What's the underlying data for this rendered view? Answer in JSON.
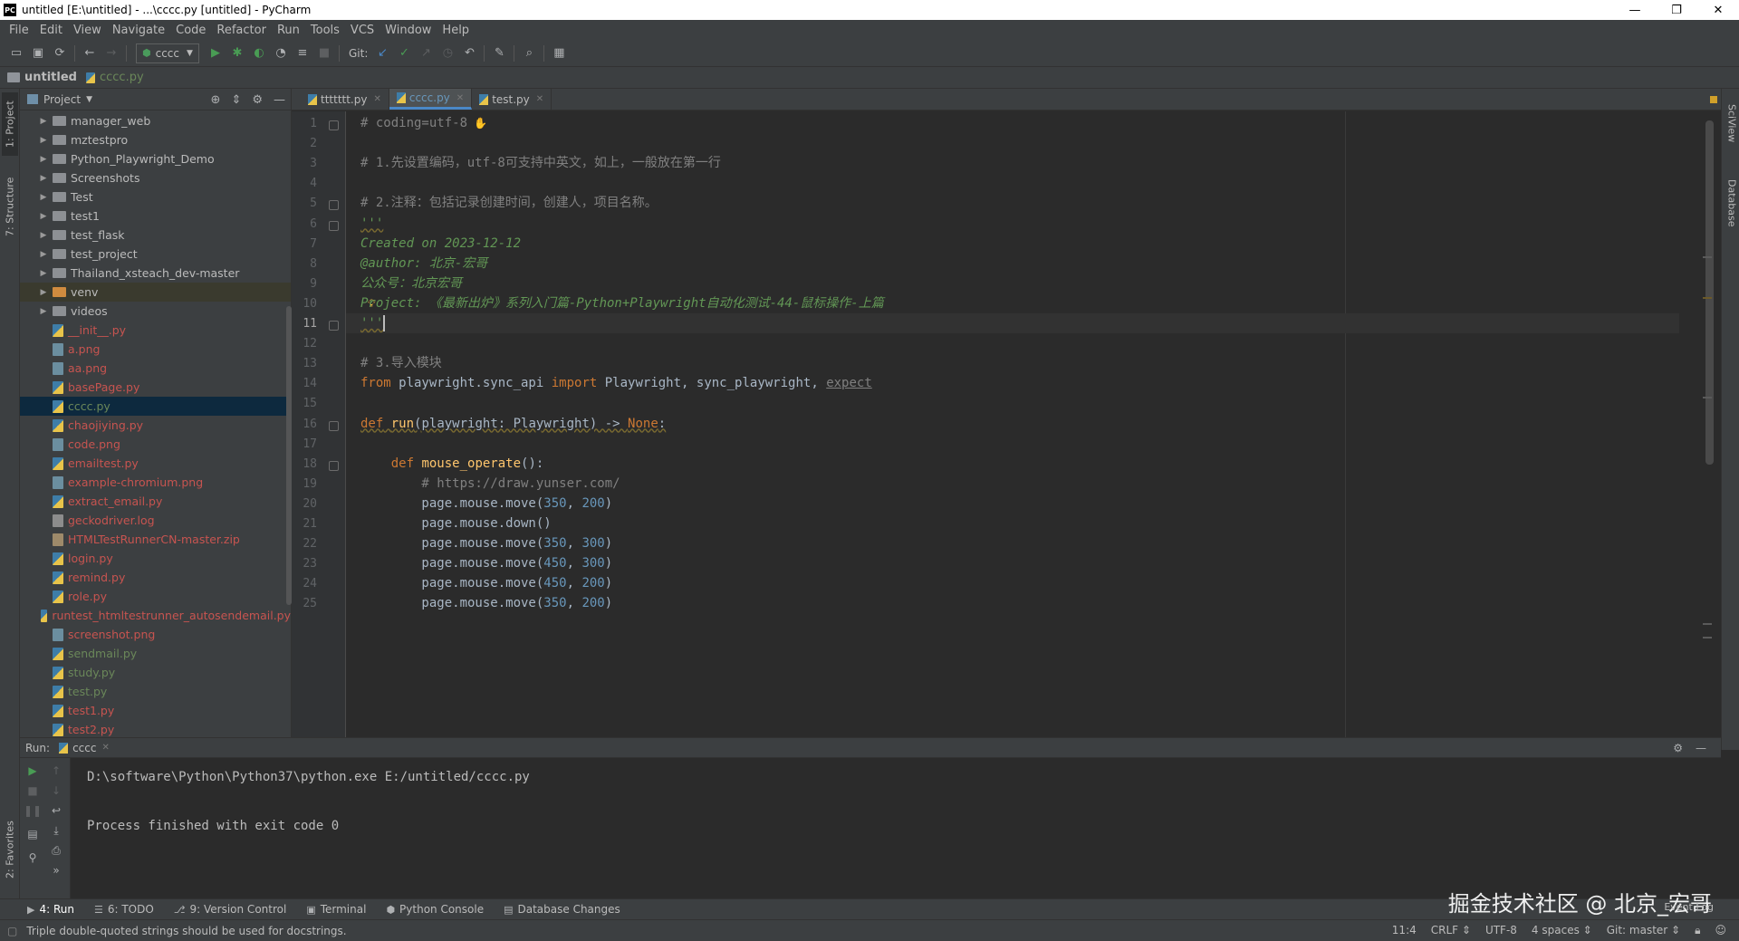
{
  "window": {
    "title": "untitled [E:\\untitled] - ...\\cccc.py [untitled] - PyCharm",
    "app_icon": "PC",
    "minimize": "—",
    "maximize": "❐",
    "close": "✕"
  },
  "menu": [
    "File",
    "Edit",
    "View",
    "Navigate",
    "Code",
    "Refactor",
    "Run",
    "Tools",
    "VCS",
    "Window",
    "Help"
  ],
  "toolbar": {
    "run_config": "cccc",
    "git_label": "Git:"
  },
  "navbar": {
    "project": "untitled",
    "file": "cccc.py"
  },
  "left_strip": {
    "project_tab": "1: Project",
    "structure_tab": "7: Structure",
    "favorites_tab": "2: Favorites"
  },
  "right_strip": {
    "sciview_tab": "SciView",
    "database_tab": "Database"
  },
  "project_panel": {
    "title": "Project",
    "items": [
      {
        "name": "manager_web",
        "kind": "dir"
      },
      {
        "name": "mztestpro",
        "kind": "dir"
      },
      {
        "name": "Python_Playwright_Demo",
        "kind": "dir"
      },
      {
        "name": "Screenshots",
        "kind": "dir"
      },
      {
        "name": "Test",
        "kind": "dir"
      },
      {
        "name": "test1",
        "kind": "dir"
      },
      {
        "name": "test_flask",
        "kind": "dir"
      },
      {
        "name": "test_project",
        "kind": "dir"
      },
      {
        "name": "Thailand_xsteach_dev-master",
        "kind": "dir"
      },
      {
        "name": "venv",
        "kind": "venv"
      },
      {
        "name": "videos",
        "kind": "dir"
      },
      {
        "name": "__init__.py",
        "kind": "py"
      },
      {
        "name": "a.png",
        "kind": "png"
      },
      {
        "name": "aa.png",
        "kind": "png"
      },
      {
        "name": "basePage.py",
        "kind": "py"
      },
      {
        "name": "cccc.py",
        "kind": "py",
        "selected": true
      },
      {
        "name": "chaojiying.py",
        "kind": "py"
      },
      {
        "name": "code.png",
        "kind": "png"
      },
      {
        "name": "emailtest.py",
        "kind": "py"
      },
      {
        "name": "example-chromium.png",
        "kind": "png"
      },
      {
        "name": "extract_email.py",
        "kind": "py"
      },
      {
        "name": "geckodriver.log",
        "kind": "log"
      },
      {
        "name": "HTMLTestRunnerCN-master.zip",
        "kind": "zip"
      },
      {
        "name": "login.py",
        "kind": "py"
      },
      {
        "name": "remind.py",
        "kind": "py"
      },
      {
        "name": "role.py",
        "kind": "py"
      },
      {
        "name": "runtest_htmltestrunner_autosendemail.py",
        "kind": "py"
      },
      {
        "name": "screenshot.png",
        "kind": "png"
      },
      {
        "name": "sendmail.py",
        "kind": "py"
      },
      {
        "name": "study.py",
        "kind": "py"
      },
      {
        "name": "test.py",
        "kind": "py"
      },
      {
        "name": "test1.py",
        "kind": "py"
      },
      {
        "name": "test2.py",
        "kind": "py"
      }
    ]
  },
  "editor": {
    "tabs": [
      {
        "label": "ttttttt.py",
        "active": false
      },
      {
        "label": "cccc.py",
        "active": true
      },
      {
        "label": "test.py",
        "active": false
      }
    ],
    "current_line": 11,
    "lines": [
      [
        {
          "t": "# coding=utf-8",
          "c": "cm"
        }
      ],
      [],
      [
        {
          "t": "# 1.先设置编码，utf-8可支持中英文，如上，一般放在第一行",
          "c": "cm"
        }
      ],
      [],
      [
        {
          "t": "# 2.注释：包括记录创建时间，创建人，项目名称。",
          "c": "cm"
        }
      ],
      [
        {
          "t": "'''",
          "c": "doc wavy"
        }
      ],
      [
        {
          "t": "Created on 2023-12-12",
          "c": "doc"
        }
      ],
      [
        {
          "t": "@author: 北京-宏哥",
          "c": "doc"
        }
      ],
      [
        {
          "t": "公众号：北京宏哥",
          "c": "doc"
        }
      ],
      [
        {
          "t": "Project: 《最新出炉》系列入门篇-Python+Playwright自动化测试-44-鼠标操作-上篇",
          "c": "doc"
        }
      ],
      [
        {
          "t": "'''",
          "c": "doc wavy"
        }
      ],
      [],
      [
        {
          "t": "# 3.导入模块",
          "c": "cm"
        }
      ],
      [
        {
          "t": "from",
          "c": "kw"
        },
        {
          "t": " playwright.sync_api ",
          "c": "plain"
        },
        {
          "t": "import",
          "c": "kw"
        },
        {
          "t": " Playwright, sync_playwright, ",
          "c": "plain"
        },
        {
          "t": "expect",
          "c": "unused"
        }
      ],
      [],
      [
        {
          "t": "def",
          "c": "kw wavy"
        },
        {
          "t": " ",
          "c": "plain wavy"
        },
        {
          "t": "run",
          "c": "fn wavy"
        },
        {
          "t": "(playwright: Playwright) -> ",
          "c": "plain wavy"
        },
        {
          "t": "None",
          "c": "kw wavy"
        },
        {
          "t": ":",
          "c": "plain wavy"
        }
      ],
      [],
      [
        {
          "t": "    ",
          "c": "plain"
        },
        {
          "t": "def",
          "c": "kw"
        },
        {
          "t": " ",
          "c": "plain"
        },
        {
          "t": "mouse_operate",
          "c": "fn"
        },
        {
          "t": "():",
          "c": "plain"
        }
      ],
      [
        {
          "t": "        # https://draw.yunser.com/",
          "c": "cm"
        }
      ],
      [
        {
          "t": "        page.mouse.move(",
          "c": "plain"
        },
        {
          "t": "350",
          "c": "num"
        },
        {
          "t": ", ",
          "c": "plain"
        },
        {
          "t": "200",
          "c": "num"
        },
        {
          "t": ")",
          "c": "plain"
        }
      ],
      [
        {
          "t": "        page.mouse.down()",
          "c": "plain"
        }
      ],
      [
        {
          "t": "        page.mouse.move(",
          "c": "plain"
        },
        {
          "t": "350",
          "c": "num"
        },
        {
          "t": ", ",
          "c": "plain"
        },
        {
          "t": "300",
          "c": "num"
        },
        {
          "t": ")",
          "c": "plain"
        }
      ],
      [
        {
          "t": "        page.mouse.move(",
          "c": "plain"
        },
        {
          "t": "450",
          "c": "num"
        },
        {
          "t": ", ",
          "c": "plain"
        },
        {
          "t": "300",
          "c": "num"
        },
        {
          "t": ")",
          "c": "plain"
        }
      ],
      [
        {
          "t": "        page.mouse.move(",
          "c": "plain"
        },
        {
          "t": "450",
          "c": "num"
        },
        {
          "t": ", ",
          "c": "plain"
        },
        {
          "t": "200",
          "c": "num"
        },
        {
          "t": ")",
          "c": "plain"
        }
      ],
      [
        {
          "t": "        page.mouse.move(",
          "c": "plain"
        },
        {
          "t": "350",
          "c": "num"
        },
        {
          "t": ", ",
          "c": "plain"
        },
        {
          "t": "200",
          "c": "num"
        },
        {
          "t": ")",
          "c": "plain"
        }
      ]
    ]
  },
  "run_panel": {
    "label": "Run:",
    "tab": "cccc",
    "output": [
      "D:\\software\\Python\\Python37\\python.exe E:/untitled/cccc.py",
      "",
      "Process finished with exit code 0"
    ]
  },
  "bottom_tabs": [
    {
      "icon": "▶",
      "label": "4: Run",
      "active": true
    },
    {
      "icon": "☰",
      "label": "6: TODO"
    },
    {
      "icon": "⎇",
      "label": "9: Version Control"
    },
    {
      "icon": "▣",
      "label": "Terminal"
    },
    {
      "icon": "⬢",
      "label": "Python Console"
    },
    {
      "icon": "▤",
      "label": "Database Changes"
    }
  ],
  "watermark": "掘金技术社区 @ 北京_宏哥",
  "event_log": "Event Log",
  "status": {
    "message": "Triple double-quoted strings should be used for docstrings.",
    "position": "11:4",
    "line_sep": "CRLF ⇕",
    "encoding": "UTF-8",
    "indent": "4 spaces ⇕",
    "git": "Git: master ⇕"
  },
  "colors": {
    "bg_editor": "#2b2b2b",
    "bg_panel": "#3c3f41",
    "keyword": "#cc7832",
    "function": "#ffc66d",
    "number": "#6897bb",
    "comment": "#808080",
    "docstring": "#629755",
    "selection": "#0d293e"
  }
}
